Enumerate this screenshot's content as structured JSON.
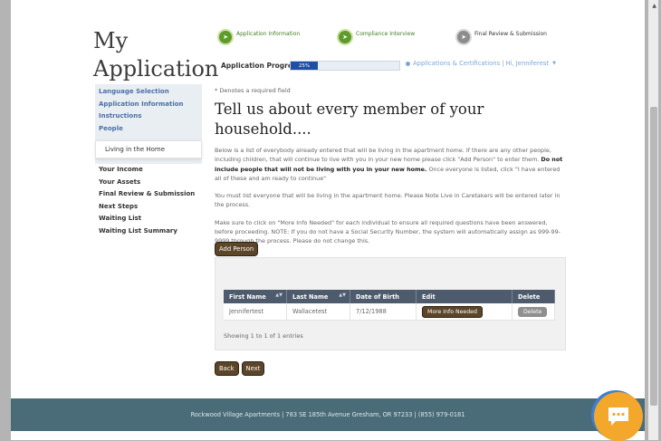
{
  "page_title": {
    "line1": "My",
    "line2": "Application"
  },
  "steps": [
    {
      "label": "Application Information",
      "state": "done",
      "icon": "check-arrow-icon"
    },
    {
      "label": "Compliance Interview",
      "state": "done",
      "icon": "check-arrow-icon"
    },
    {
      "label": "Final Review & Submission",
      "state": "todo",
      "icon": "arrow-icon"
    }
  ],
  "progress": {
    "label": "Application Progress",
    "value_text": "25%",
    "value": 0.25
  },
  "top_nav": {
    "link": "Applications & Certifications",
    "separator": "|",
    "user": "Hi, Jenniferest",
    "caret": "▼"
  },
  "sidebar": {
    "items_top": [
      "Language Selection",
      "Application Information",
      "Instructions",
      "People"
    ],
    "active": "Living in the Home",
    "items_bottom": [
      "Your Income",
      "Your Assets",
      "Final Review & Submission",
      "Next Steps",
      "Waiting List",
      "Waiting List Summary"
    ]
  },
  "main": {
    "required_note": "* Denotes a required field",
    "heading": "Tell us about every member of your household....",
    "para1_a": "Below is a list of everybody already entered that will be living in the apartment home. If there are any other people, including children, that will continue to live with you in your new home please click \"Add Person\" to enter them. ",
    "para1_b": "Do not include people that will not be living with you in your new home.",
    "para1_c": " Once everyone is listed, click \"I have entered all of these and am ready to continue\"",
    "para2": "You must list everyone that will be living in the apartment home.  Please Note Live in Caretakers will be entered later in the process.",
    "para3": "Make sure to click on \"More Info Needed\" for each individual to ensure all required questions have been answered, before proceeding.  NOTE:  If you do not have a Social Security Number, the system will automatically assign as 999-99-9999 through the process.  Please do not change this."
  },
  "buttons": {
    "add_person": "Add Person",
    "back": "Back",
    "next": "Next"
  },
  "table": {
    "headers": [
      "First Name",
      "Last Name",
      "Date of Birth",
      "Edit",
      "Delete"
    ],
    "rows": [
      {
        "first": "Jennifertest",
        "last": "Wallacetest",
        "dob": "7/12/1988",
        "edit": "More Info Needed",
        "delete": "Delete"
      }
    ],
    "showing": "Showing 1 to 1 of 1 entries"
  },
  "footer": "Rockwood Village Apartments  |  783 SE 185th Avenue  Gresham, OR 97233  |  (855) 979-0181",
  "colors": {
    "accent_brown": "#5c4528",
    "footer_teal": "#4a6b78",
    "progress_blue": "#1f4ea6",
    "step_green": "#5d9b2a",
    "chat_orange": "#f3a72b"
  }
}
